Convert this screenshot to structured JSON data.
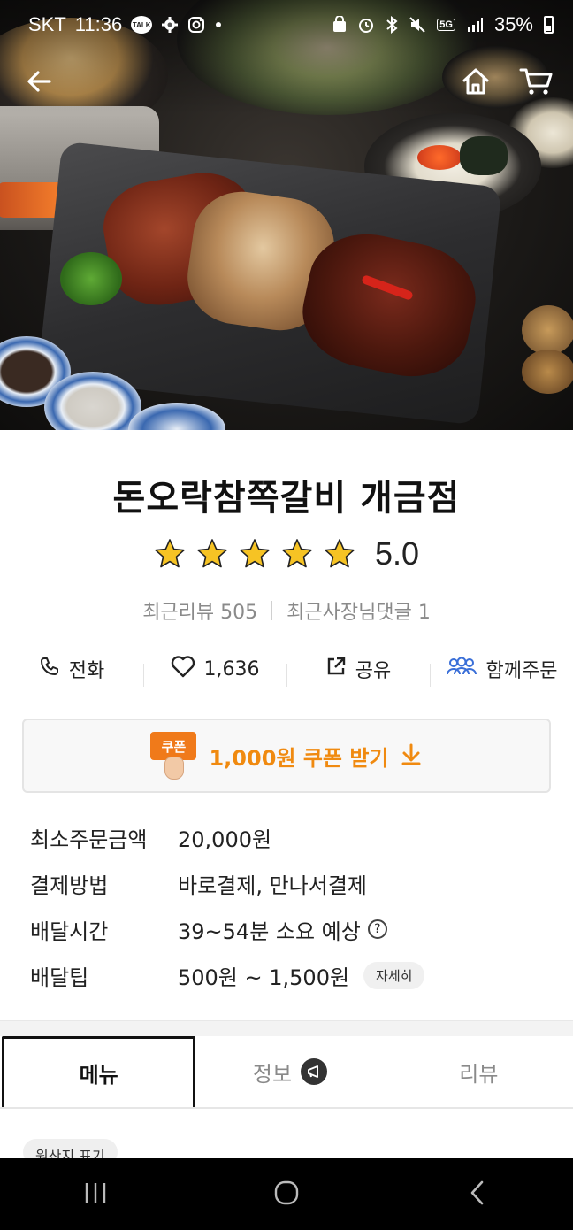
{
  "status_bar": {
    "carrier": "SKT",
    "time": "11:36",
    "talk_badge": "TALK",
    "network": "5G",
    "battery": "35%"
  },
  "header": {
    "back_icon": "arrow-left-icon",
    "home_icon": "home-icon",
    "cart_icon": "cart-icon"
  },
  "store": {
    "name": "돈오락참쪽갈비 개금점",
    "rating": "5.0",
    "rating_stars": 5,
    "recent_reviews_label": "최근리뷰 505",
    "owner_replies_label": "최근사장님댓글 1"
  },
  "actions": {
    "call": "전화",
    "likes": "1,636",
    "share": "공유",
    "group_order": "함께주문"
  },
  "coupon": {
    "badge": "쿠폰",
    "text": "1,000원 쿠폰 받기"
  },
  "info": [
    {
      "key": "최소주문금액",
      "value": "20,000원"
    },
    {
      "key": "결제방법",
      "value": "바로결제, 만나서결제"
    },
    {
      "key": "배달시간",
      "value": "39~54분 소요 예상"
    },
    {
      "key": "배달팁",
      "value": "500원 ~ 1,500원",
      "chip": "자세히"
    }
  ],
  "tabs": [
    {
      "label": "메뉴",
      "active": true
    },
    {
      "label": "정보",
      "active": false
    },
    {
      "label": "리뷰",
      "active": false
    }
  ],
  "origin_chip": "원산지 표기",
  "colors": {
    "accent_orange": "#f08a10",
    "star_yellow": "#f6c324",
    "group_blue": "#3a6fd8"
  }
}
